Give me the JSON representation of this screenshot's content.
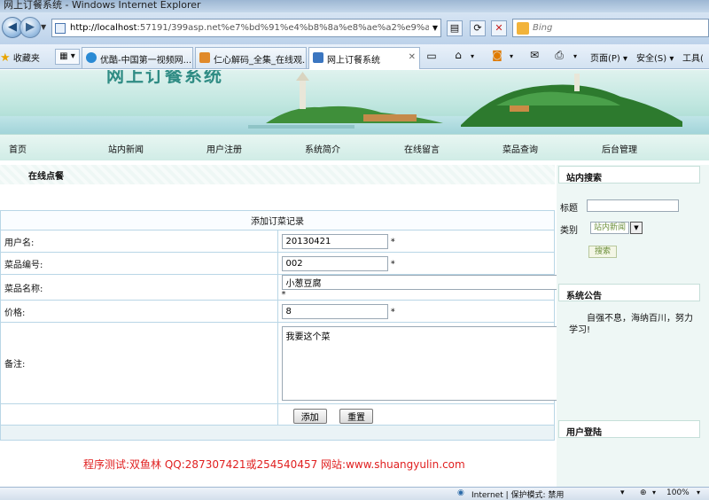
{
  "browser": {
    "window_title": "网上订餐系统 - Windows Internet Explorer",
    "url_host": "http://localhost",
    "url_rest": ":57191/399asp.net%e7%bd%91%e4%b8%8a%e8%ae%a2%e9%a4%90%",
    "search_placeholder": "Bing",
    "favorites_label": "收藏夹",
    "tabs": [
      {
        "label": "优酷-中国第一视频网...",
        "color": "#2a8ad4"
      },
      {
        "label": "仁心解码_全集_在线观...",
        "color": "#e08a2a"
      },
      {
        "label": "网上订餐系统",
        "color": "#3b76c0"
      }
    ],
    "commands": {
      "page": "页面(P)",
      "safety": "安全(S)",
      "tools": "工具("
    }
  },
  "site": {
    "title": "网上订餐系统",
    "nav": [
      "首页",
      "站内新闻",
      "用户注册",
      "系统简介",
      "在线留言",
      "菜品查询",
      "后台管理"
    ]
  },
  "main": {
    "section_title": "在线点餐",
    "form": {
      "caption": "添加订菜记录",
      "required_mark": "*",
      "username": {
        "label": "用户名:",
        "value": "20130421"
      },
      "dish_no": {
        "label": "菜品编号:",
        "value": "002"
      },
      "dish_name": {
        "label": "菜品名称:",
        "value": "小葱豆腐"
      },
      "price": {
        "label": "价格:",
        "value": "8"
      },
      "remark": {
        "label": "备注:",
        "value": "我要这个菜"
      },
      "add_label": "添加",
      "reset_label": "重置"
    },
    "credit": "程序测试:双鱼林 QQ:287307421或254540457 网站:www.shuangyulin.com"
  },
  "sidebar": {
    "search_title": "站内搜索",
    "title_label": "标题",
    "category_label": "类别",
    "category_selected": "站内新闻",
    "search_button": "搜索",
    "notice_title": "系统公告",
    "notice_text": "自强不息，海纳百川，努力学习!",
    "login_title": "用户登陆"
  },
  "status": {
    "zone": "Internet | 保护模式: 禁用",
    "zoom": "100%"
  }
}
